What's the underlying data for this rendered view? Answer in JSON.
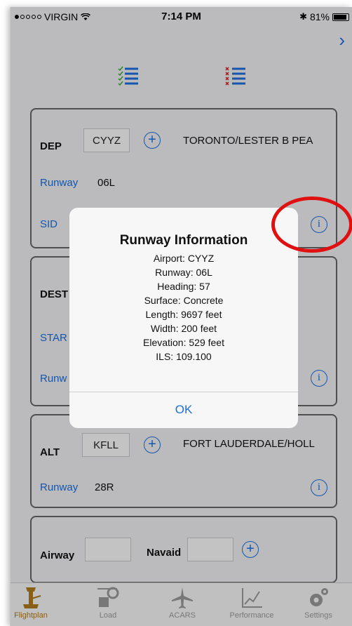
{
  "status_bar": {
    "carrier": "VIRGIN",
    "time": "7:14 PM",
    "battery": "81%"
  },
  "nav": {
    "next_icon": "chevron-right-icon"
  },
  "toolbar": {
    "icons": [
      "checklist-icon",
      "cross-list-icon"
    ]
  },
  "departure": {
    "label": "DEP",
    "code": "CYYZ",
    "airport_name": "TORONTO/LESTER B PEA",
    "runway_label": "Runway",
    "runway_value": "06L",
    "sid_label": "SID"
  },
  "destination": {
    "label": "DEST",
    "star_label": "STAR",
    "runway_label": "Runw"
  },
  "alternate": {
    "label": "ALT",
    "code": "KFLL",
    "airport_name": "FORT LAUDERDALE/HOLL",
    "runway_label": "Runway",
    "runway_value": "28R"
  },
  "route": {
    "airway_label": "Airway",
    "navaid_label": "Navaid"
  },
  "dialog": {
    "title": "Runway Information",
    "lines": [
      "Airport: CYYZ",
      "Runway: 06L",
      "Heading: 57",
      "Surface: Concrete",
      "Length: 9697 feet",
      "Width: 200 feet",
      "Elevation: 529 feet",
      "ILS: 109.100"
    ],
    "ok": "OK"
  },
  "tab_bar": {
    "tabs": [
      {
        "label": "Flightplan",
        "icon": "tower-icon",
        "active": true
      },
      {
        "label": "Load",
        "icon": "cargo-icon",
        "active": false
      },
      {
        "label": "ACARS",
        "icon": "airplane-icon",
        "active": false
      },
      {
        "label": "Performance",
        "icon": "chart-icon",
        "active": false
      },
      {
        "label": "Settings",
        "icon": "gears-icon",
        "active": false
      }
    ]
  },
  "colors": {
    "accent": "#1a6fe0",
    "active_tab": "#b07a1c",
    "highlight_circle": "#e01010"
  }
}
